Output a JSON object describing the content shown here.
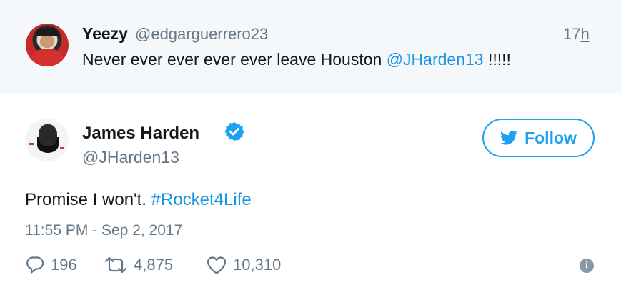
{
  "parent_tweet": {
    "author_name": "Yeezy",
    "author_handle": "@edgarguerrero23",
    "time_prefix": "17",
    "time_suffix": "h",
    "text_before": "Never ever ever ever ever leave Houston ",
    "mention": "@JHarden13",
    "text_after": " !!!!!"
  },
  "tweet": {
    "author_name": "James Harden",
    "author_handle": "@JHarden13",
    "verified": true,
    "follow_label": "Follow",
    "text_before": "Promise I won't. ",
    "hashtag": "#Rocket4Life",
    "timestamp": "11:55 PM - Sep 2, 2017",
    "replies": "196",
    "retweets": "4,875",
    "likes": "10,310"
  },
  "colors": {
    "link": "#1b95e0",
    "brand_blue": "#1da1f2",
    "muted": "#657786",
    "parent_bg": "#f5f8fa"
  },
  "icons": [
    "reply-icon",
    "retweet-icon",
    "heart-icon",
    "info-icon",
    "twitter-bird-icon",
    "verified-badge-icon"
  ]
}
